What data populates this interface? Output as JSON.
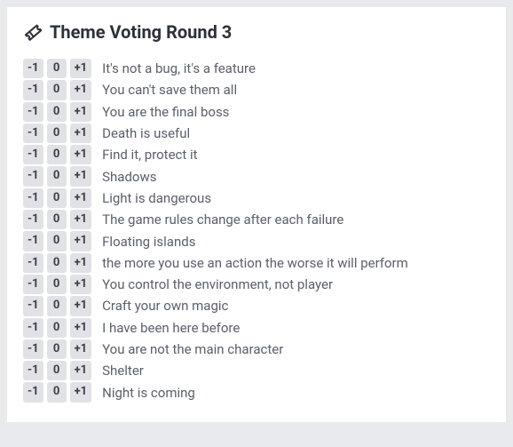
{
  "header": {
    "title": "Theme Voting Round 3"
  },
  "vote": {
    "down": "-1",
    "neutral": "0",
    "up": "+1"
  },
  "themes": [
    {
      "label": "It's not a bug, it's a feature"
    },
    {
      "label": "You can't save them all"
    },
    {
      "label": "You are the final boss"
    },
    {
      "label": "Death is useful"
    },
    {
      "label": "Find it, protect it"
    },
    {
      "label": "Shadows"
    },
    {
      "label": "Light is dangerous"
    },
    {
      "label": "The game rules change after each failure"
    },
    {
      "label": "Floating islands"
    },
    {
      "label": "the more you use an action the worse it will perform"
    },
    {
      "label": "You control the environment, not player"
    },
    {
      "label": "Craft your own magic"
    },
    {
      "label": "I have been here before"
    },
    {
      "label": "You are not the main character"
    },
    {
      "label": "Shelter"
    },
    {
      "label": "Night is coming"
    }
  ]
}
